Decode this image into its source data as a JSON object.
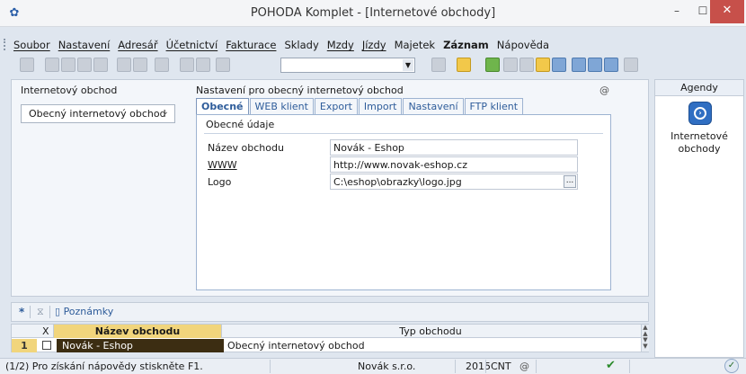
{
  "window": {
    "title": "POHODA Komplet - [Internetové obchody]",
    "logo_icon": "pohoda-logo-icon",
    "controls": {
      "minimize": "–",
      "maximize": "☐",
      "close": "✕"
    }
  },
  "menu": {
    "items": [
      "Soubor",
      "Nastavení",
      "Adresář",
      "Účetnictví",
      "Fakturace",
      "Sklady",
      "Mzdy",
      "Jízdy",
      "Majetek",
      "Záznam",
      "Nápověda"
    ]
  },
  "main": {
    "left_label": "Internetový obchod",
    "select_value": "Obecný internetový obchod",
    "right_label": "Nastavení pro obecný internetový obchod",
    "at_symbol": "@",
    "tabs": [
      {
        "label": "Obecné",
        "active": true
      },
      {
        "label": "WEB klient",
        "active": false
      },
      {
        "label": "Export",
        "active": false
      },
      {
        "label": "Import",
        "active": false
      },
      {
        "label": "Nastavení",
        "active": false
      },
      {
        "label": "FTP klient",
        "active": false
      }
    ],
    "section_title": "Obecné údaje",
    "fields": [
      {
        "label": "Název obchodu",
        "value": "Novák - Eshop"
      },
      {
        "label": "WWW",
        "value": "http://www.novak-eshop.cz"
      },
      {
        "label": "Logo",
        "value": "C:\\eshop\\obrazky\\logo.jpg"
      }
    ],
    "dots_label": "..."
  },
  "agenda": {
    "header": "Agendy",
    "item_label_line1": "Internetové",
    "item_label_line2": "obchody"
  },
  "list": {
    "toolbar": {
      "new_symbol": "*",
      "notes_label": "Poznámky"
    },
    "headers": {
      "x": "X",
      "name": "Název obchodu",
      "type": "Typ obchodu"
    },
    "rows": [
      {
        "num": "1",
        "name": "Novák - Eshop",
        "type": "Obecný internetový obchod"
      }
    ]
  },
  "status": {
    "help": "(1/2) Pro získání nápovědy stiskněte F1.",
    "company": "Novák s.r.o.",
    "year": "2015",
    "cnt": "CNT",
    "at": "@"
  },
  "colors": {
    "selected_row": "#3c2d12",
    "header_highlight": "#f1d57c",
    "accent": "#2e5c9a"
  }
}
